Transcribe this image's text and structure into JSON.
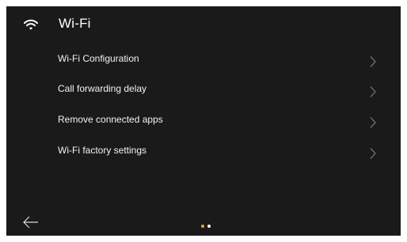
{
  "header": {
    "title": "Wi-Fi",
    "icon": "wifi-icon"
  },
  "menu": {
    "items": [
      {
        "label": "Wi-Fi Configuration",
        "icon": "chevron-right-icon"
      },
      {
        "label": "Call forwarding delay",
        "icon": "chevron-right-icon"
      },
      {
        "label": "Remove connected apps",
        "icon": "chevron-right-icon"
      },
      {
        "label": "Wi-Fi factory settings",
        "icon": "chevron-right-icon"
      }
    ]
  },
  "footer": {
    "back_icon": "back-arrow-icon",
    "pager": {
      "page_count": 2,
      "active_page": 1,
      "active_color": "#f0a623",
      "inactive_color": "#ffffff"
    }
  },
  "colors": {
    "background": "#1a1a1a",
    "text": "#ffffff",
    "chevron": "#6f6f6f"
  }
}
